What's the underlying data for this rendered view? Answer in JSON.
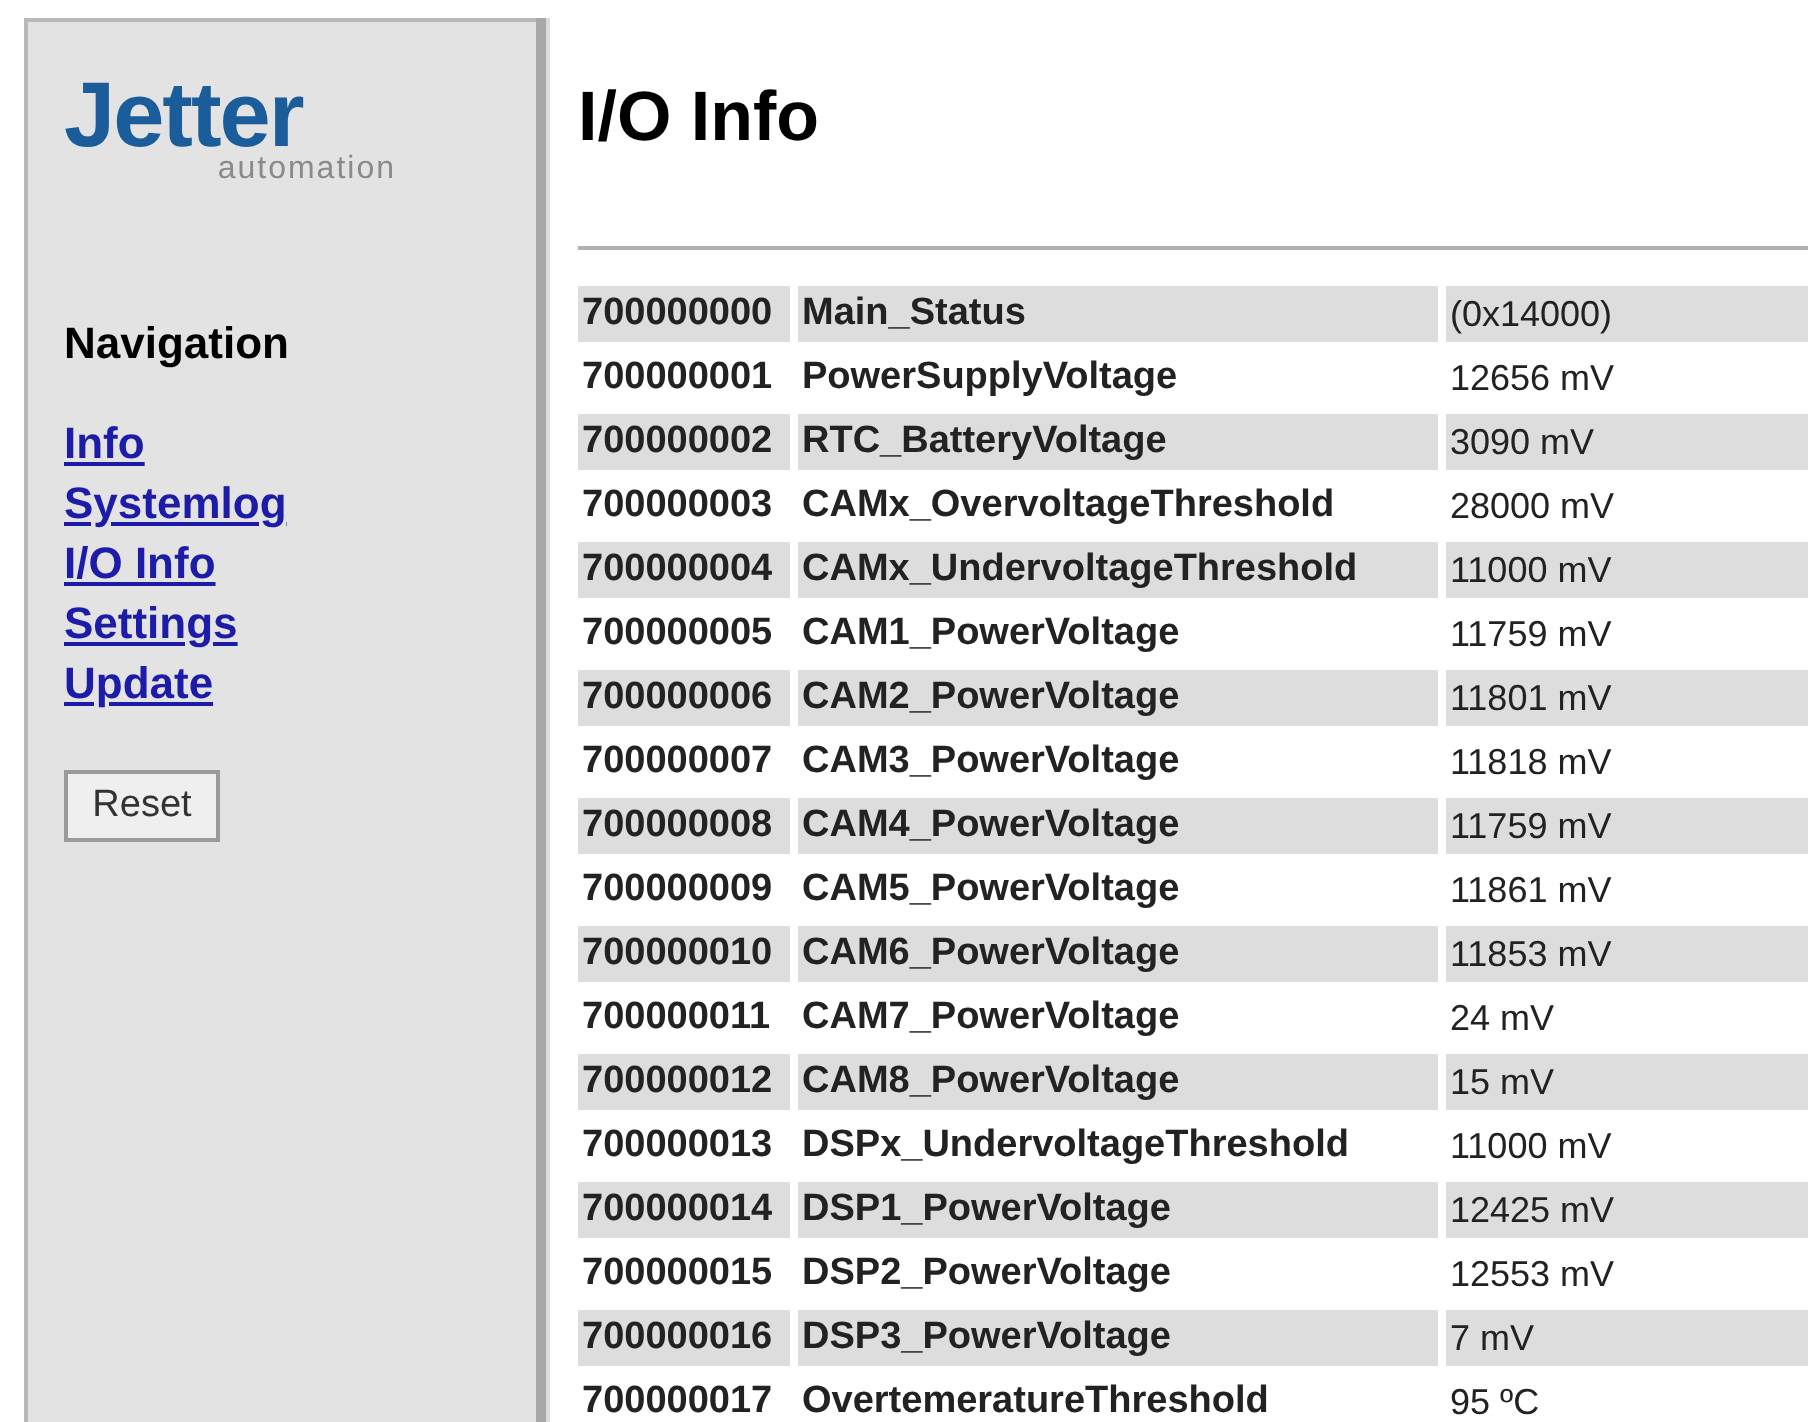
{
  "logo": {
    "brand": "Jetter",
    "tagline": "automation"
  },
  "navigation": {
    "title": "Navigation",
    "links": [
      {
        "label": "Info"
      },
      {
        "label": "Systemlog"
      },
      {
        "label": "I/O Info"
      },
      {
        "label": "Settings"
      },
      {
        "label": "Update"
      }
    ],
    "reset_button": "Reset"
  },
  "page": {
    "title": "I/O Info"
  },
  "table": {
    "rows": [
      {
        "id": "700000000",
        "name": "Main_Status",
        "value": "(0x14000)"
      },
      {
        "id": "700000001",
        "name": "PowerSupplyVoltage",
        "value": "12656 mV"
      },
      {
        "id": "700000002",
        "name": "RTC_BatteryVoltage",
        "value": "3090 mV"
      },
      {
        "id": "700000003",
        "name": "CAMx_OvervoltageThreshold",
        "value": "28000 mV"
      },
      {
        "id": "700000004",
        "name": "CAMx_UndervoltageThreshold",
        "value": "11000 mV"
      },
      {
        "id": "700000005",
        "name": "CAM1_PowerVoltage",
        "value": "11759 mV"
      },
      {
        "id": "700000006",
        "name": "CAM2_PowerVoltage",
        "value": "11801 mV"
      },
      {
        "id": "700000007",
        "name": "CAM3_PowerVoltage",
        "value": "11818 mV"
      },
      {
        "id": "700000008",
        "name": "CAM4_PowerVoltage",
        "value": "11759 mV"
      },
      {
        "id": "700000009",
        "name": "CAM5_PowerVoltage",
        "value": "11861 mV"
      },
      {
        "id": "700000010",
        "name": "CAM6_PowerVoltage",
        "value": "11853 mV"
      },
      {
        "id": "700000011",
        "name": "CAM7_PowerVoltage",
        "value": "24 mV"
      },
      {
        "id": "700000012",
        "name": "CAM8_PowerVoltage",
        "value": "15 mV"
      },
      {
        "id": "700000013",
        "name": "DSPx_UndervoltageThreshold",
        "value": "11000 mV"
      },
      {
        "id": "700000014",
        "name": "DSP1_PowerVoltage",
        "value": "12425 mV"
      },
      {
        "id": "700000015",
        "name": "DSP2_PowerVoltage",
        "value": "12553 mV"
      },
      {
        "id": "700000016",
        "name": "DSP3_PowerVoltage",
        "value": "7 mV"
      },
      {
        "id": "700000017",
        "name": "OvertemeratureThreshold",
        "value": "95 ºC"
      }
    ]
  }
}
